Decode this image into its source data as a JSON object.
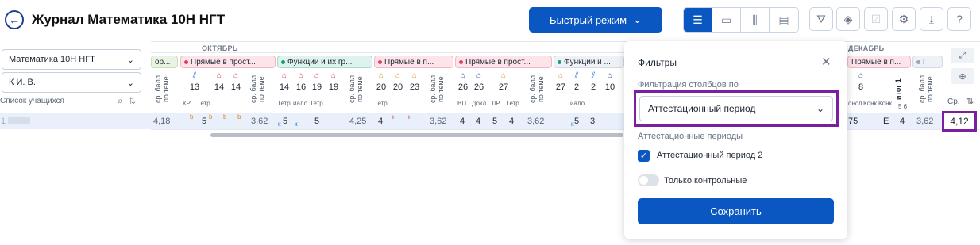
{
  "header": {
    "title": "Журнал Математика 10Н НГТ",
    "quick_mode": "Быстрый режим"
  },
  "left": {
    "subject": "Математика 10Н НГТ",
    "teacher": "К И. В.",
    "students_label": "Список учащихся",
    "row_num": "1"
  },
  "months": {
    "oct": "ОКТЯБРЬ",
    "dec": "ДЕКАБРЬ"
  },
  "topics": [
    "ор...",
    "Прямые в прост...",
    "Функции и их гр...",
    "Прямые в п...",
    "Прямые в прост...",
    "Функции и ...",
    "Прямые в п...",
    "Г"
  ],
  "columns": {
    "avg_label": "ср. балл по теме",
    "days": [
      "13",
      "14",
      "14",
      "14",
      "16",
      "19",
      "19",
      "20",
      "20",
      "23",
      "26",
      "26",
      "27",
      "27",
      "2",
      "2",
      "10",
      "8"
    ],
    "types": [
      "КР",
      "Тетр",
      "Тетр",
      "иало",
      "Тетр",
      "Тетр",
      "ВП",
      "Докл",
      "ЛР",
      "Тетр",
      "иало",
      "онсл",
      "Конк",
      "Конк"
    ],
    "itog": "итог 1",
    "itog_sub": "5 6",
    "sr_label": "Ср."
  },
  "row": {
    "values": [
      "4,18",
      "5",
      "3,62",
      "5",
      "4,25",
      "4",
      "3,62",
      "4",
      "4",
      "5",
      "4",
      "3,62",
      "5",
      "3",
      "75",
      "E",
      "4",
      "3,62"
    ],
    "flag": "b",
    "flag_n": "н",
    "flag_k": "к",
    "final_avg": "4,12"
  },
  "filter_panel": {
    "title": "Фильтры",
    "filter_by_label": "Фильтрация столбцов по",
    "selected": "Аттестационный период",
    "periods_label": "Аттестационные периоды",
    "period_option": "Аттестационный период 2",
    "period_checked": true,
    "only_control": "Только контрольные",
    "only_control_on": false,
    "save": "Сохранить"
  },
  "colors": {
    "primary": "#0a57c2",
    "highlight": "#7b1fa2"
  }
}
